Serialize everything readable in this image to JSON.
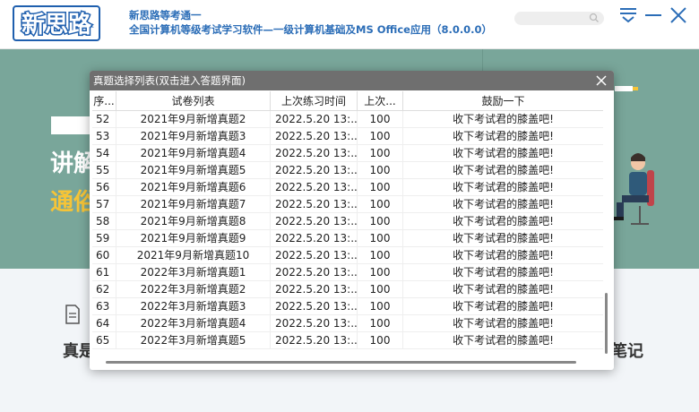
{
  "header": {
    "logo_text": "新思路",
    "app_title": "新思路等考通一",
    "app_subtitle": "全国计算机等级考试学习软件—一级计算机基础及MS Office应用（8.0.0.0）"
  },
  "banner": {
    "line1": "讲解",
    "line2": "通俗"
  },
  "lower": {
    "left_text": "真是",
    "right_text": "笔记"
  },
  "dialog": {
    "title": "真题选择列表(双击进入答题界面)",
    "columns": [
      "序...",
      "试卷列表",
      "上次练习时间",
      "上次...",
      "鼓励一下"
    ],
    "rows": [
      [
        "52",
        "2021年9月新增真题2",
        "2022.5.20  13:...",
        "100",
        "收下考试君的膝盖吧!"
      ],
      [
        "53",
        "2021年9月新增真题3",
        "2022.5.20  13:...",
        "100",
        "收下考试君的膝盖吧!"
      ],
      [
        "54",
        "2021年9月新增真题4",
        "2022.5.20  13:...",
        "100",
        "收下考试君的膝盖吧!"
      ],
      [
        "55",
        "2021年9月新增真题5",
        "2022.5.20  13:...",
        "100",
        "收下考试君的膝盖吧!"
      ],
      [
        "56",
        "2021年9月新增真题6",
        "2022.5.20  13:...",
        "100",
        "收下考试君的膝盖吧!"
      ],
      [
        "57",
        "2021年9月新增真题7",
        "2022.5.20  13:...",
        "100",
        "收下考试君的膝盖吧!"
      ],
      [
        "58",
        "2021年9月新增真题8",
        "2022.5.20  13:...",
        "100",
        "收下考试君的膝盖吧!"
      ],
      [
        "59",
        "2021年9月新增真题9",
        "2022.5.20  13:...",
        "100",
        "收下考试君的膝盖吧!"
      ],
      [
        "60",
        "2021年9月新增真题10",
        "2022.5.20  13:...",
        "100",
        "收下考试君的膝盖吧!"
      ],
      [
        "61",
        "2022年3月新增真题1",
        "2022.5.20  13:...",
        "100",
        "收下考试君的膝盖吧!"
      ],
      [
        "62",
        "2022年3月新增真题2",
        "2022.5.20  13:...",
        "100",
        "收下考试君的膝盖吧!"
      ],
      [
        "63",
        "2022年3月新增真题3",
        "2022.5.20  13:...",
        "100",
        "收下考试君的膝盖吧!"
      ],
      [
        "64",
        "2022年3月新增真题4",
        "2022.5.20  13:...",
        "100",
        "收下考试君的膝盖吧!"
      ],
      [
        "65",
        "2022年3月新增真题5",
        "2022.5.20  13:...",
        "100",
        "收下考试君的膝盖吧!"
      ]
    ]
  },
  "icons": {
    "search": "search-icon",
    "menu": "menu-icon",
    "minimize": "minimize-icon",
    "close": "close-icon",
    "dialog_close": "close-icon",
    "document": "document-icon"
  },
  "colors": {
    "brand_blue": "#2b6db7",
    "banner_green": "#79a69a",
    "banner_yellow": "#f6c437",
    "dialog_titlebar": "#6f6f6f"
  }
}
